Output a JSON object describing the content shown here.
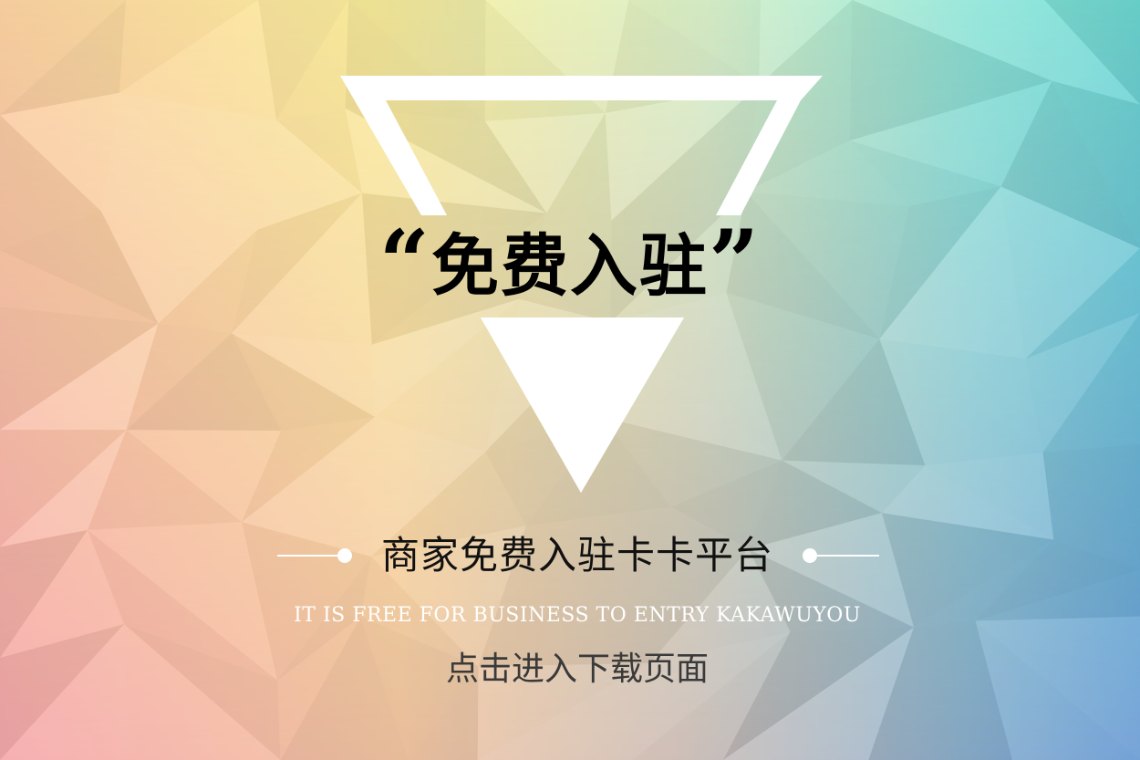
{
  "banner": {
    "open_quote": "“",
    "headline": "免费入驻",
    "close_quote": "”",
    "subtitle": "商家免费入驻卡卡平台",
    "english_line": "IT IS FREE FOR BUSINESS TO ENTRY KAKAWUYOU",
    "cta_label": "点击进入下载页面"
  },
  "colors": {
    "gradient_top_left": "#fdd9a8",
    "gradient_yellow": "#fbf1a0",
    "gradient_cyan": "#7fe6da",
    "gradient_blue": "#6ea3d6",
    "gradient_pink": "#f1a8b4",
    "triangle": "#ffffff",
    "headline": "#000000",
    "cta_text": "#3a3a3a"
  }
}
